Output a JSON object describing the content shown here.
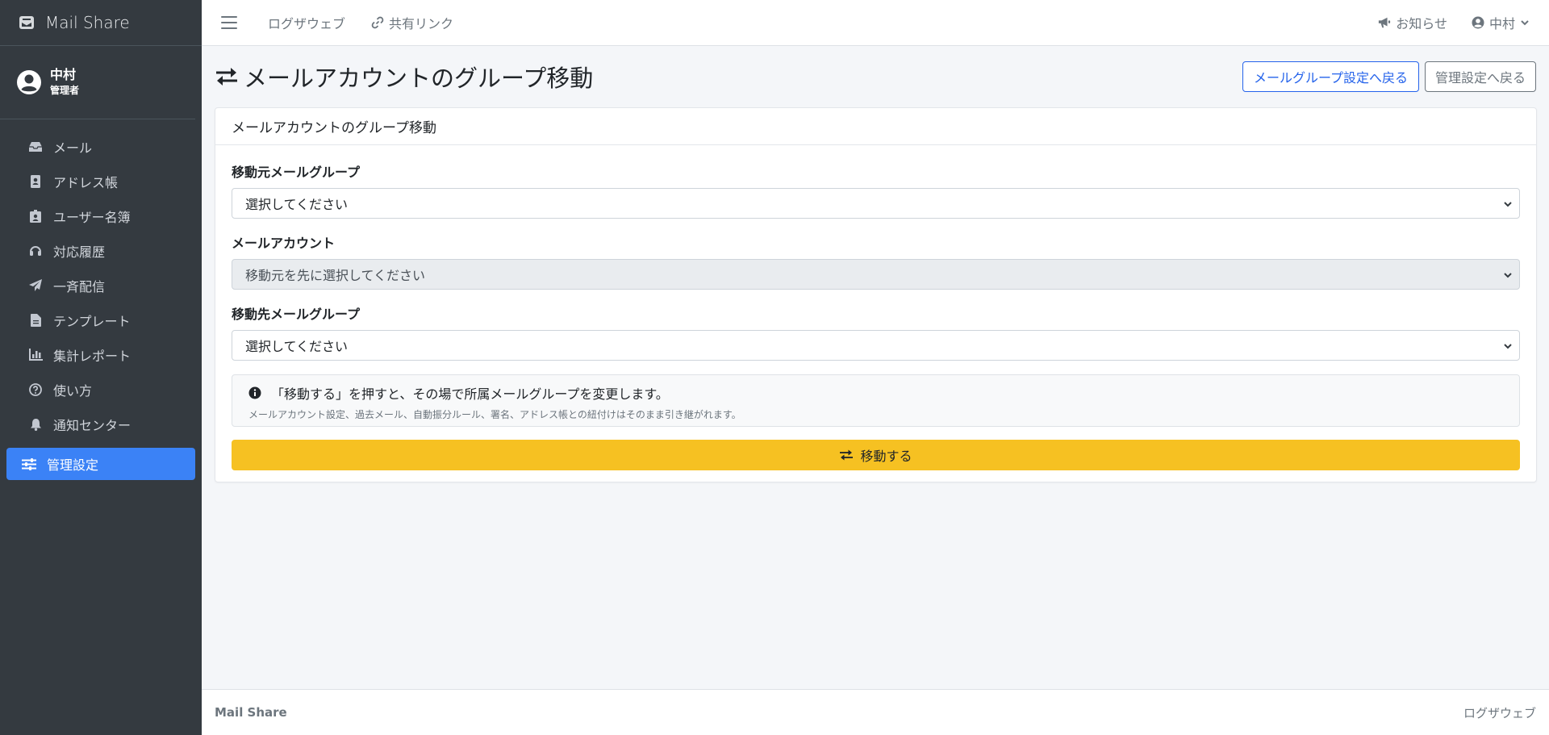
{
  "brand": {
    "name": "Mail Share",
    "icon": "mail-bulk-icon"
  },
  "user_panel": {
    "name": "中村",
    "role": "管理者"
  },
  "sidebar": {
    "items": [
      {
        "label": "メール",
        "icon": "inbox-icon"
      },
      {
        "label": "アドレス帳",
        "icon": "address-book-icon"
      },
      {
        "label": "ユーザー名簿",
        "icon": "id-badge-icon"
      },
      {
        "label": "対応履歴",
        "icon": "headset-icon"
      },
      {
        "label": "一斉配信",
        "icon": "paper-plane-icon"
      },
      {
        "label": "テンプレート",
        "icon": "file-icon"
      },
      {
        "label": "集計レポート",
        "icon": "chart-icon"
      },
      {
        "label": "使い方",
        "icon": "question-circle-icon"
      },
      {
        "label": "通知センター",
        "icon": "bell-icon"
      },
      {
        "label": "管理設定",
        "icon": "sliders-icon",
        "active": true
      }
    ]
  },
  "topbar": {
    "link_home": "ログザウェブ",
    "link_share": "共有リンク",
    "notice": "お知らせ",
    "user": "中村"
  },
  "page": {
    "title": "メールアカウントのグループ移動",
    "back_group_btn": "メールグループ設定へ戻る",
    "back_admin_btn": "管理設定へ戻る"
  },
  "card": {
    "header": "メールアカウントのグループ移動",
    "source_label": "移動元メールグループ",
    "source_value": "選択してください",
    "account_label": "メールアカウント",
    "account_value": "移動元を先に選択してください",
    "dest_label": "移動先メールグループ",
    "dest_value": "選択してください",
    "info_main": "「移動する」を押すと、その場で所属メールグループを変更します。",
    "info_sub": "メールアカウント設定、過去メール、自動振分ルール、署名、アドレス帳との紐付けはそのまま引き継がれます。",
    "submit": "移動する"
  },
  "footer": {
    "left": "Mail Share",
    "right": "ログザウェブ"
  },
  "colors": {
    "sidebar_bg": "#343a40",
    "active": "#3b82f6",
    "primary": "#2563eb",
    "warning": "#f6c122"
  }
}
